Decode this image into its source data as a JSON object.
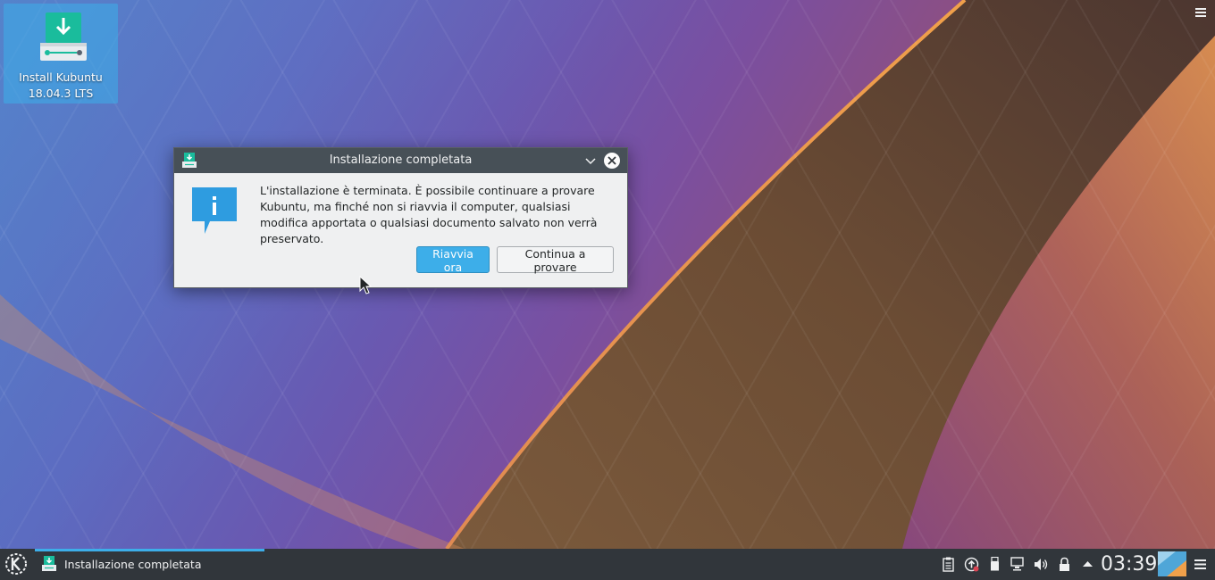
{
  "desktop": {
    "icon": {
      "label_line1": "Install Kubuntu",
      "label_line2": "18.04.3 LTS",
      "icon_name": "installer-download-icon"
    },
    "menu_icon": "hamburger-menu-icon"
  },
  "dialog": {
    "title": "Installazione completata",
    "icon_name": "installer-icon",
    "message": "L'installazione è terminata. È possibile continuare a provare Kubuntu, ma finché non si riavvia il computer, qualsiasi modifica apportata o qualsiasi documento salvato non verrà preservato.",
    "info_icon": "info-icon",
    "buttons": {
      "restart": "Riavvia ora",
      "continue": "Continua a provare"
    },
    "titlebar_controls": [
      "minimize-chevron-icon",
      "close-icon"
    ]
  },
  "taskbar": {
    "launcher_icon": "kde-logo-icon",
    "tasks": [
      {
        "label": "Installazione completata",
        "active": true
      }
    ],
    "tray": [
      "clipboard-icon",
      "update-icon",
      "usb-icon",
      "network-icon",
      "volume-icon",
      "lock-icon",
      "tray-expand-icon"
    ],
    "clock": "03:39",
    "panel_menu_icon": "hamburger-menu-icon"
  },
  "colors": {
    "accent": "#3daee9",
    "titlebar": "#475057",
    "panel": "#31363b",
    "dialog_bg": "#eff0f1"
  }
}
